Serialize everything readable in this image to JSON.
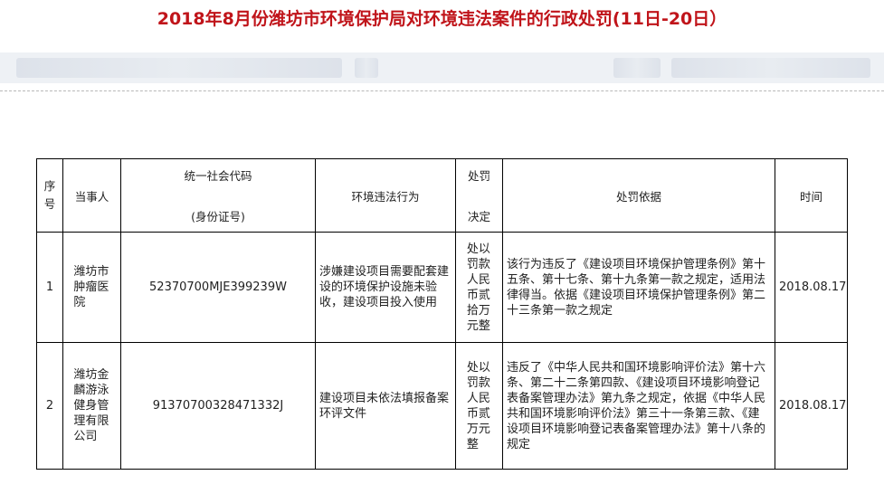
{
  "page_title": "2018年8月份潍坊市环境保护局对环境违法案件的行政处罚(11日-20日）",
  "table": {
    "headers": {
      "index": "序号",
      "party": "当事人",
      "code_top": "统一社会代码",
      "code_bottom": "(身份证号)",
      "behavior": "环境违法行为",
      "punish_top": "处罚",
      "punish_bottom": "决定",
      "basis": "处罚依据",
      "time": "时间"
    },
    "rows": [
      {
        "index": "1",
        "party": "潍坊市肿瘤医院",
        "code": "52370700MJE399239W",
        "behavior": "涉嫌建设项目需要配套建设的环境保护设施未验收，建设项目投入使用",
        "punishment": "处以罚款人民币贰拾万元整",
        "basis": "该行为违反了《建设项目环境保护管理条例》第十五条、第十七条、第十九条第一款之规定，适用法律得当。依据《建设项目环境保护管理条例》第二十三条第一款之规定",
        "time": "2018.08.17"
      },
      {
        "index": "2",
        "party": "潍坊金麟游泳健身管理有限公司",
        "code": "91370700328471332J",
        "behavior": "建设项目未依法填报备案环评文件",
        "punishment": "处以罚款人民币贰万元整",
        "basis": "违反了《中华人民共和国环境影响评价法》第十六条、第二十二条第四款、《建设项目环境影响登记表备案管理办法》第九条之规定，依据《中华人民共和国环境影响评价法》第三十一条第三款、《建设项目环境影响登记表备案管理办法》第十八条的规定",
        "time": "2018.08.17"
      }
    ]
  }
}
